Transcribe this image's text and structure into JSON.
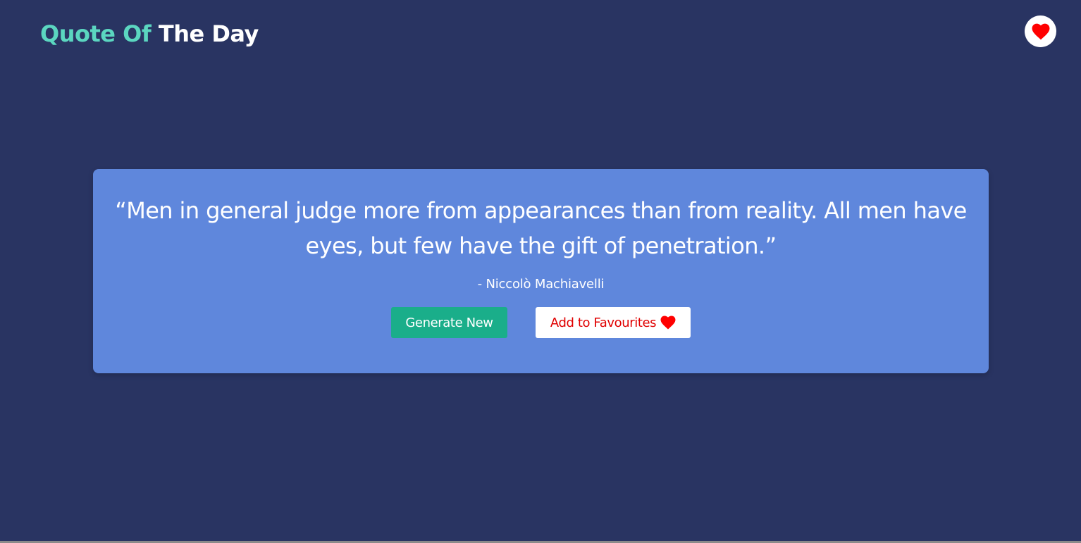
{
  "header": {
    "title_accent": "Quote Of",
    "title_rest": "The Day",
    "favourites_icon": "heart-icon"
  },
  "quote": {
    "text": "“Men in general judge more from appearances than from reality. All men have eyes, but few have the gift of penetration.”",
    "author": "- Niccolò Machiavelli"
  },
  "actions": {
    "generate_label": "Generate New",
    "favourite_label": "Add to Favourites",
    "favourite_icon": "heart-icon"
  },
  "colors": {
    "background": "#293462",
    "accent": "#5bd6c0",
    "card": "#5f87dc",
    "generate_button": "#1aae8a",
    "heart": "#ff0000"
  }
}
